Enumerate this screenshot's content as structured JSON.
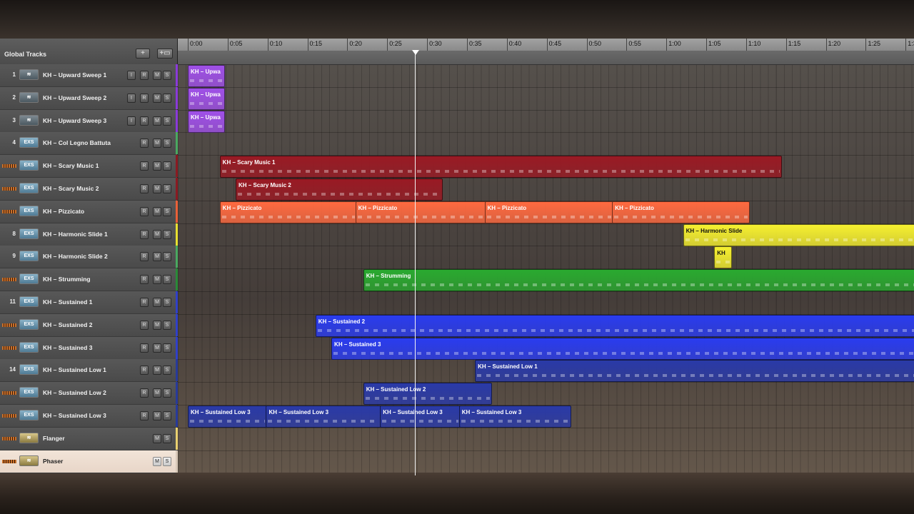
{
  "global_tracks": {
    "label": "Global Tracks",
    "add_label": "+",
    "folder_label": "+▭"
  },
  "ruler": {
    "labels": [
      "0:00",
      "0:05",
      "0:10",
      "0:15",
      "0:20",
      "0:25",
      "0:30",
      "0:35",
      "0:40",
      "0:45",
      "0:50",
      "0:55",
      "1:00",
      "1:05",
      "1:10",
      "1:15",
      "1:20",
      "1:25",
      "1:3"
    ]
  },
  "tracks": [
    {
      "num": "1",
      "name": "KH – Upward Sweep 1",
      "icon": "waveform-icon",
      "color": "#8a3ad9",
      "buttons": [
        "I",
        "R",
        "M",
        "S"
      ]
    },
    {
      "num": "2",
      "name": "KH – Upward Sweep 2",
      "icon": "waveform-icon",
      "color": "#8a3ad9",
      "buttons": [
        "I",
        "R",
        "M",
        "S"
      ]
    },
    {
      "num": "3",
      "name": "KH – Upward Sweep 3",
      "icon": "waveform-icon",
      "color": "#8a3ad9",
      "buttons": [
        "I",
        "R",
        "M",
        "S"
      ]
    },
    {
      "num": "4",
      "name": "KH – Col Legno Battuta",
      "icon": "EXS",
      "color": "#4aa860",
      "buttons": [
        "R",
        "M",
        "S"
      ]
    },
    {
      "num": "",
      "name": "KH – Scary Music 1",
      "icon": "EXS",
      "color": "#8a1a22",
      "buttons": [
        "R",
        "M",
        "S"
      ]
    },
    {
      "num": "",
      "name": "KH – Scary Music 2",
      "icon": "EXS",
      "color": "#8a1a22",
      "buttons": [
        "R",
        "M",
        "S"
      ]
    },
    {
      "num": "",
      "name": "KH – Pizzicato",
      "icon": "EXS",
      "color": "#e86038",
      "buttons": [
        "R",
        "M",
        "S"
      ]
    },
    {
      "num": "8",
      "name": "KH – Harmonic Slide 1",
      "icon": "EXS",
      "color": "#e8e030",
      "buttons": [
        "R",
        "M",
        "S"
      ]
    },
    {
      "num": "9",
      "name": "KH – Harmonic Slide 2",
      "icon": "EXS",
      "color": "#4aa860",
      "buttons": [
        "R",
        "M",
        "S"
      ]
    },
    {
      "num": "",
      "name": "KH – Strumming",
      "icon": "EXS",
      "color": "#2a8a38",
      "buttons": [
        "R",
        "M",
        "S"
      ]
    },
    {
      "num": "11",
      "name": "KH – Sustained 1",
      "icon": "EXS",
      "color": "#3040c8",
      "buttons": [
        "R",
        "M",
        "S"
      ]
    },
    {
      "num": "",
      "name": "KH – Sustained 2",
      "icon": "EXS",
      "color": "#3040c8",
      "buttons": [
        "R",
        "M",
        "S"
      ]
    },
    {
      "num": "",
      "name": "KH – Sustained 3",
      "icon": "EXS",
      "color": "#3040c8",
      "buttons": [
        "R",
        "M",
        "S"
      ]
    },
    {
      "num": "14",
      "name": "KH – Sustained Low 1",
      "icon": "EXS",
      "color": "#283a9a",
      "buttons": [
        "R",
        "M",
        "S"
      ]
    },
    {
      "num": "",
      "name": "KH – Sustained Low 2",
      "icon": "EXS",
      "color": "#283a9a",
      "buttons": [
        "R",
        "M",
        "S"
      ]
    },
    {
      "num": "",
      "name": "KH – Sustained Low 3",
      "icon": "EXS",
      "color": "#283a9a",
      "buttons": [
        "R",
        "M",
        "S"
      ]
    },
    {
      "num": "",
      "name": "Flanger",
      "icon": "waveform-icon",
      "color": "#e8d070",
      "buttons": [
        "M",
        "S"
      ]
    },
    {
      "num": "",
      "name": "Phaser",
      "icon": "waveform-icon",
      "color": "#d8c8b8",
      "buttons": [
        "M",
        "S"
      ]
    }
  ],
  "regions": [
    {
      "track": 0,
      "label": "KH – Upwa",
      "start": 0.0,
      "end": 4.5,
      "color": "#a050e8"
    },
    {
      "track": 1,
      "label": "KH – Upwa",
      "start": 0.0,
      "end": 4.5,
      "color": "#a050e8"
    },
    {
      "track": 2,
      "label": "KH – Upwa",
      "start": 0.0,
      "end": 4.5,
      "color": "#a050e8"
    },
    {
      "track": 4,
      "label": "KH – Scary Music 1",
      "start": 4.0,
      "end": 74.3,
      "color": "#9a1a24"
    },
    {
      "track": 5,
      "label": "KH – Scary Music 2",
      "start": 6.0,
      "end": 31.8,
      "color": "#9a1a24"
    },
    {
      "track": 6,
      "label": "KH – Pizzicato",
      "start": 4.0,
      "end": 21.0,
      "color": "#ff6a40"
    },
    {
      "track": 6,
      "label": "KH – Pizzicato",
      "start": 21.0,
      "end": 37.2,
      "color": "#ff6a40"
    },
    {
      "track": 6,
      "label": "KH – Pizzicato",
      "start": 37.2,
      "end": 53.2,
      "color": "#ff6a40"
    },
    {
      "track": 6,
      "label": "KH – Pizzicato",
      "start": 53.2,
      "end": 70.3,
      "color": "#ff6a40"
    },
    {
      "track": 7,
      "label": "KH – Harmonic Slide",
      "start": 62.1,
      "end": 92.0,
      "color": "#f6f030"
    },
    {
      "track": 8,
      "label": "KH",
      "start": 66.0,
      "end": 68.0,
      "color": "#f6f030"
    },
    {
      "track": 9,
      "label": "KH – Strumming",
      "start": 22.0,
      "end": 92.0,
      "color": "#2aaa30"
    },
    {
      "track": 11,
      "label": "KH – Sustained 2",
      "start": 16.0,
      "end": 92.0,
      "color": "#2a3cf0"
    },
    {
      "track": 12,
      "label": "KH – Sustained 3",
      "start": 18.0,
      "end": 92.0,
      "color": "#2a3cf0"
    },
    {
      "track": 13,
      "label": "KH – Sustained Low 1",
      "start": 36.0,
      "end": 92.0,
      "color": "#2a3aa8"
    },
    {
      "track": 14,
      "label": "KH – Sustained Low 2",
      "start": 22.0,
      "end": 38.0,
      "color": "#2a3aa8"
    },
    {
      "track": 15,
      "label": "KH – Sustained Low 3",
      "start": 0.0,
      "end": 9.8,
      "color": "#2a3aa8"
    },
    {
      "track": 15,
      "label": "KH – Sustained Low 3",
      "start": 9.8,
      "end": 24.1,
      "color": "#2a3aa8"
    },
    {
      "track": 15,
      "label": "KH – Sustained Low 3",
      "start": 24.1,
      "end": 34.0,
      "color": "#2a3aa8"
    },
    {
      "track": 15,
      "label": "KH – Sustained Low 3",
      "start": 34.0,
      "end": 47.9,
      "color": "#2a3aa8"
    }
  ],
  "playhead_seconds": 28.6
}
